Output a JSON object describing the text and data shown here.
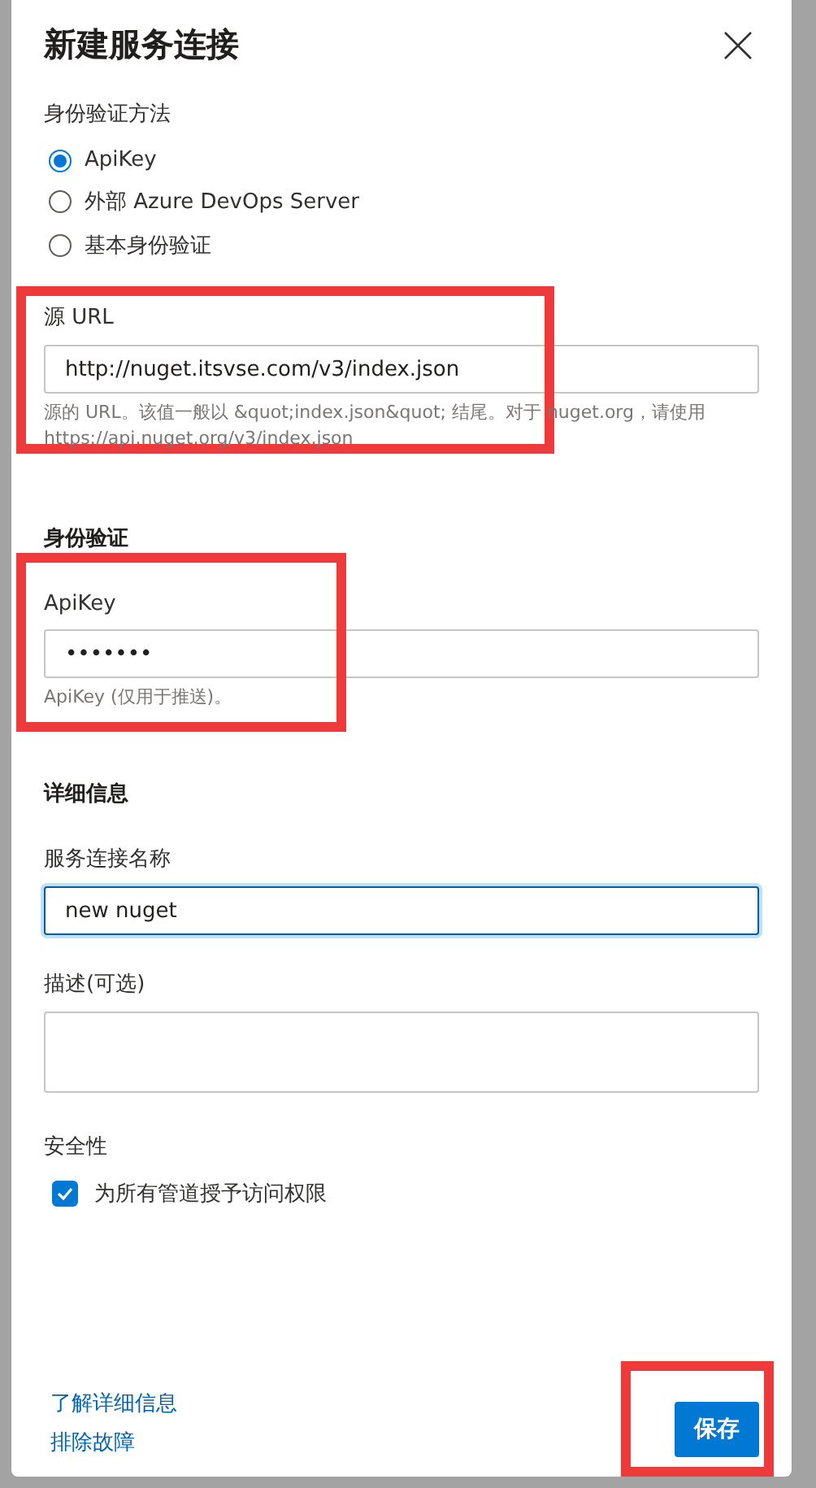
{
  "dialog": {
    "title": "新建服务连接"
  },
  "auth_method": {
    "label": "身份验证方法",
    "options": [
      {
        "label": "ApiKey",
        "selected": true
      },
      {
        "label": "外部 Azure DevOps Server",
        "selected": false
      },
      {
        "label": "基本身份验证",
        "selected": false
      }
    ]
  },
  "source_url": {
    "label": "源 URL",
    "value": "http://nuget.itsvse.com/v3/index.json",
    "help": "源的 URL。该值一般以 &quot;index.json&quot; 结尾。对于 nuget.org，请使用 https://api.nuget.org/v3/index.json"
  },
  "authentication": {
    "heading": "身份验证",
    "apikey": {
      "label": "ApiKey",
      "value": "•••••••",
      "help": "ApiKey (仅用于推送)。"
    }
  },
  "details": {
    "heading": "详细信息",
    "name": {
      "label": "服务连接名称",
      "value": "new nuget",
      "focused": true
    },
    "description": {
      "label": "描述(可选)"
    }
  },
  "security": {
    "heading": "安全性",
    "grant": {
      "label": "为所有管道授予访问权限",
      "checked": true
    }
  },
  "footer": {
    "links": [
      "了解详细信息",
      "排除故障"
    ],
    "save": "保存"
  }
}
